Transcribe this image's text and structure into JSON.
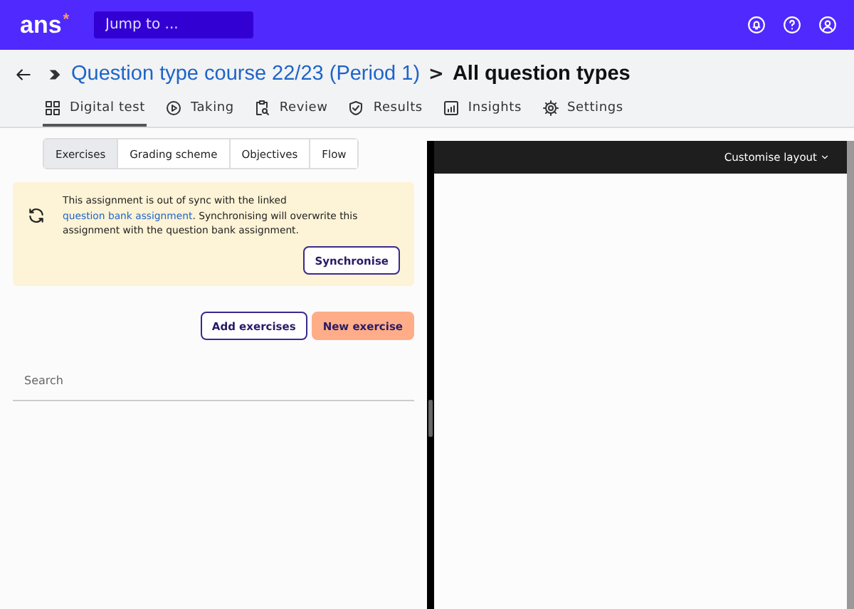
{
  "header": {
    "logo": "ans",
    "logo_mark": "*",
    "jump_placeholder": "Jump to ..."
  },
  "breadcrumb": {
    "course": "Question type course 22/23 (Period 1)",
    "separator": ">",
    "current": "All question types"
  },
  "nav_tabs": [
    {
      "label": "Digital test",
      "kind": "grid",
      "selected": true
    },
    {
      "label": "Taking",
      "kind": "play",
      "selected": false
    },
    {
      "label": "Review",
      "kind": "clipboard",
      "selected": false
    },
    {
      "label": "Results",
      "kind": "shield",
      "selected": false
    },
    {
      "label": "Insights",
      "kind": "chart",
      "selected": false
    },
    {
      "label": "Settings",
      "kind": "gear",
      "selected": false
    }
  ],
  "sub_tabs": [
    {
      "label": "Exercises",
      "selected": true
    },
    {
      "label": "Grading scheme",
      "selected": false
    },
    {
      "label": "Objectives",
      "selected": false
    },
    {
      "label": "Flow",
      "selected": false
    }
  ],
  "sync_banner": {
    "text_before": "This assignment is out of sync with the linked ",
    "link": "question bank assignment",
    "text_after": ". Synchronising will overwrite this assignment with the question bank assignment.",
    "button": "Synchronise"
  },
  "actions": [
    {
      "label": "Add exercises",
      "kind": "outline"
    },
    {
      "label": "New exercise",
      "kind": "primary"
    }
  ],
  "search": {
    "placeholder": "Search"
  },
  "preview": {
    "layout_button": "Customise layout"
  }
}
